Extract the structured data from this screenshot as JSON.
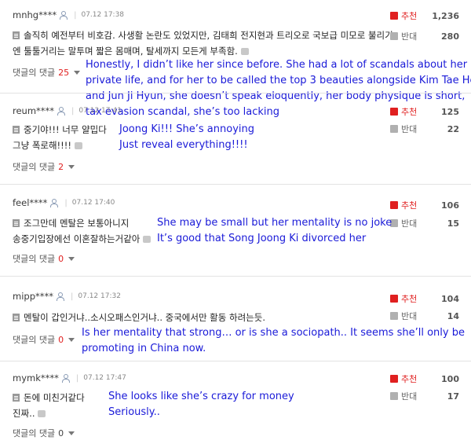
{
  "vote_labels": {
    "up": "추천",
    "down": "반대"
  },
  "reply_label": "댓글의 댓글",
  "comments": [
    {
      "user": "mnhg****",
      "date": "07.12 17:38",
      "korean_lines": [
        "솔직히 예전부터 비호감. 사생활 논란도 있었지만, 김태희 전지현과 트리오로 국보급 미모로 불리기",
        "엔 툴툴거리는 말투며 짧은 몸매며, 탈세까지 모든게 부족함."
      ],
      "reply_count": "25",
      "up": "1,236",
      "down": "280",
      "translation": [
        "Honestly, I didn’t like her since before. She had a lot of scandals about her",
        "private life, and for her to be called the top 3 beauties alongside Kim Tae Hee",
        "and Jun Ji Hyun, she doesn’t speak eloquently, her body physique is short,",
        "tax evasion scandal, she’s too lacking"
      ]
    },
    {
      "user": "reum****",
      "date": "07.12 17:41",
      "korean_lines": [
        "중기야!!! 너무 얄밉다",
        "그냥 폭로해!!!!"
      ],
      "reply_count": "2",
      "up": "125",
      "down": "22",
      "translation": [
        "Joong Ki!!! She’s annoying",
        "Just reveal everything!!!!"
      ]
    },
    {
      "user": "feel****",
      "date": "07.12 17:40",
      "korean_lines": [
        "조그만데 멘탈은 보통아니지",
        "송중기입장에선 이혼잘하는거같아"
      ],
      "reply_count": "0",
      "up": "106",
      "down": "15",
      "translation": [
        "She may be small but her mentality is no joke",
        "It’s good that Song Joong Ki divorced her"
      ]
    },
    {
      "user": "mipp****",
      "date": "07.12 17:32",
      "korean_lines": [
        "멘탈이 갑인거냐..소시오패스인거냐.. 중국에서만 활동 하려는듯."
      ],
      "reply_count": "0",
      "up": "104",
      "down": "14",
      "translation": [
        "Is her mentality that strong… or is she a sociopath.. It seems she’ll only be",
        "promoting in China now."
      ]
    },
    {
      "user": "mymk****",
      "date": "07.12 17:47",
      "korean_lines": [
        "돈에 미친거같다",
        "진짜.."
      ],
      "reply_count": "0",
      "up": "100",
      "down": "17",
      "translation": [
        "She looks like she’s crazy for money",
        "Seriously.."
      ]
    }
  ]
}
